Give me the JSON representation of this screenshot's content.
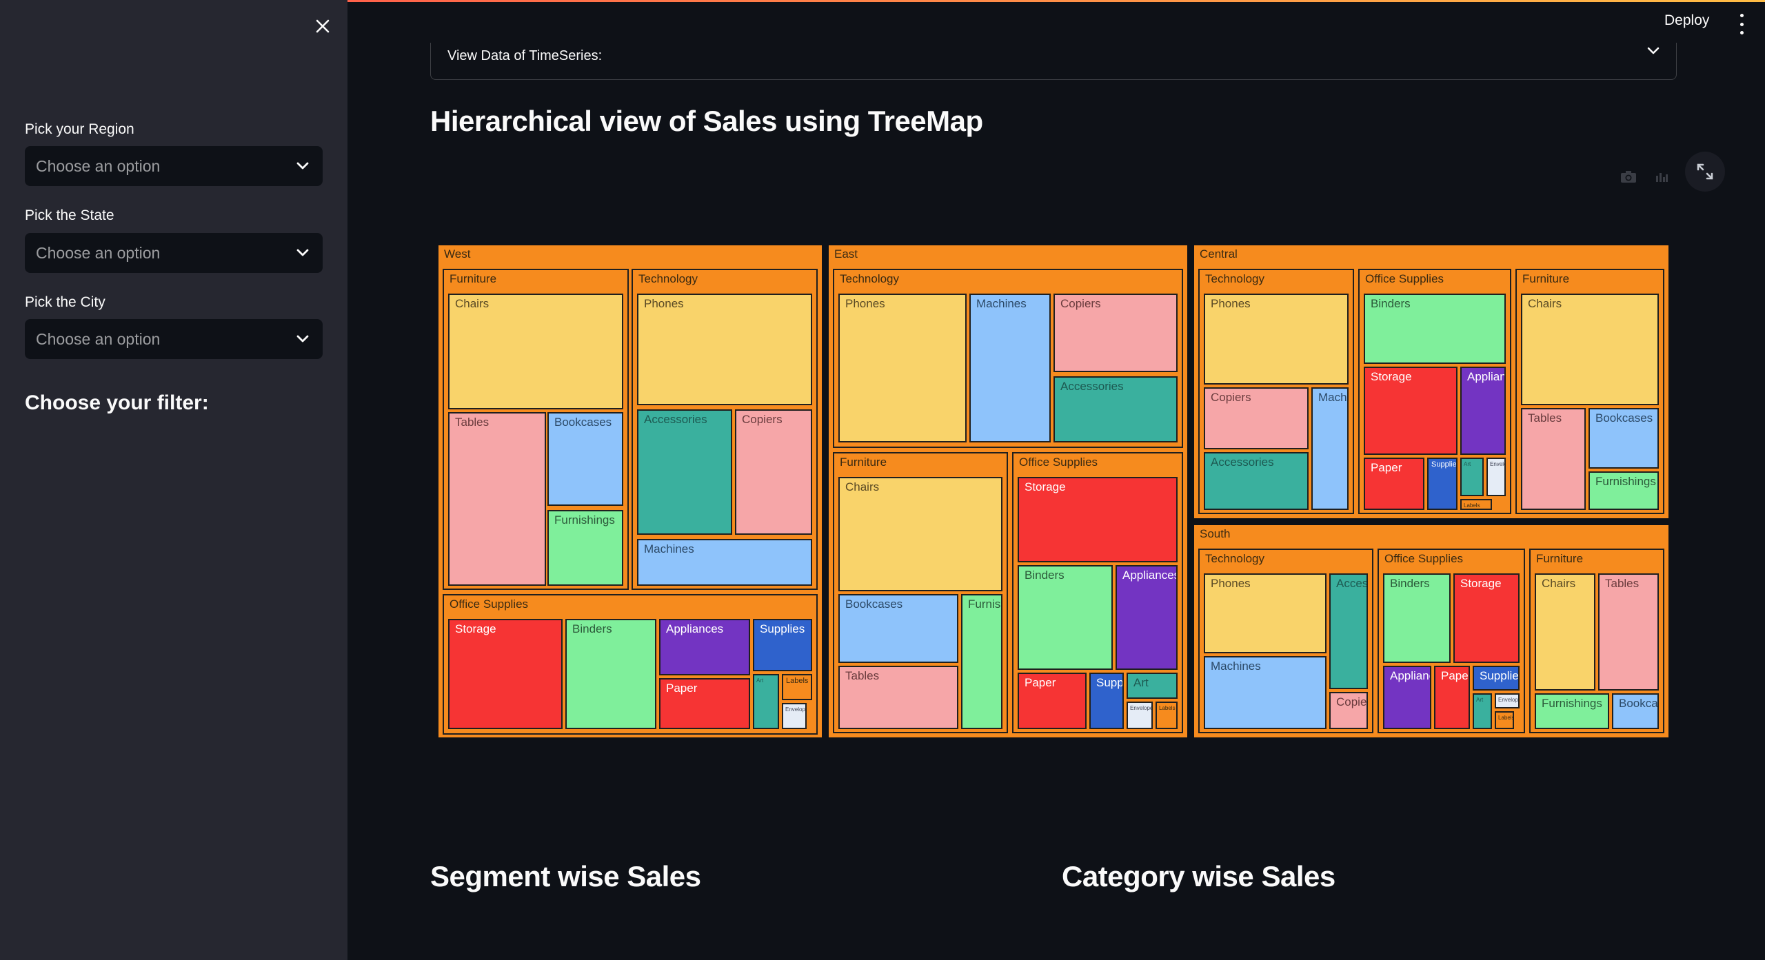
{
  "sidebar": {
    "filters": [
      {
        "label": "Pick your Region",
        "placeholder": "Choose an option"
      },
      {
        "label": "Pick the State",
        "placeholder": "Choose an option"
      },
      {
        "label": "Pick the City",
        "placeholder": "Choose an option"
      }
    ],
    "heading": "Choose your filter:"
  },
  "header": {
    "deploy_label": "Deploy"
  },
  "expander": {
    "label": "View Data of TimeSeries:"
  },
  "sections": {
    "treemap_title": "Hierarchical view of Sales using TreeMap",
    "segment_title": "Segment wise Sales",
    "category_title": "Category wise Sales"
  },
  "icons": {
    "close": "close-icon",
    "chevron": "chevron-down-icon",
    "menu": "vertical-dots-icon",
    "camera": "camera-icon",
    "autoscale": "bar-chart-icon",
    "fullscreen": "expand-icon"
  },
  "colors": {
    "background": "#0e1117",
    "sidebar": "#262730",
    "orange": "#f68b1e",
    "yellow": "#f9d36a",
    "blue": "#8ec3fb",
    "pink": "#f6a6a8",
    "teal": "#3ab09e",
    "green": "#7fef9b",
    "red": "#f63434",
    "purple": "#7334c2",
    "royal": "#2f62cc",
    "lightgray": "#e5ecf6"
  },
  "chart_data": {
    "type": "treemap",
    "title": "",
    "nodes": [
      {
        "id": "west",
        "label": "West",
        "parent": "",
        "color": "orange"
      },
      {
        "id": "west-furniture",
        "label": "Furniture",
        "parent": "west",
        "color": "orange"
      },
      {
        "id": "west-furniture-chairs",
        "label": "Chairs",
        "parent": "west-furniture",
        "color": "yellow"
      },
      {
        "id": "west-furniture-tables",
        "label": "Tables",
        "parent": "west-furniture",
        "color": "pink"
      },
      {
        "id": "west-furniture-bookcases",
        "label": "Bookcases",
        "parent": "west-furniture",
        "color": "blue"
      },
      {
        "id": "west-furniture-furnishings",
        "label": "Furnishings",
        "parent": "west-furniture",
        "color": "green"
      },
      {
        "id": "west-tech",
        "label": "Technology",
        "parent": "west",
        "color": "orange"
      },
      {
        "id": "west-tech-phones",
        "label": "Phones",
        "parent": "west-tech",
        "color": "yellow"
      },
      {
        "id": "west-tech-accessories",
        "label": "Accessories",
        "parent": "west-tech",
        "color": "teal"
      },
      {
        "id": "west-tech-copiers",
        "label": "Copiers",
        "parent": "west-tech",
        "color": "pink"
      },
      {
        "id": "west-tech-machines",
        "label": "Machines",
        "parent": "west-tech",
        "color": "blue"
      },
      {
        "id": "west-os",
        "label": "Office Supplies",
        "parent": "west",
        "color": "orange"
      },
      {
        "id": "west-os-storage",
        "label": "Storage",
        "parent": "west-os",
        "color": "red"
      },
      {
        "id": "west-os-binders",
        "label": "Binders",
        "parent": "west-os",
        "color": "green"
      },
      {
        "id": "west-os-appliances",
        "label": "Appliances",
        "parent": "west-os",
        "color": "purple"
      },
      {
        "id": "west-os-supplies",
        "label": "Supplies",
        "parent": "west-os",
        "color": "royal"
      },
      {
        "id": "west-os-paper",
        "label": "Paper",
        "parent": "west-os",
        "color": "red"
      },
      {
        "id": "west-os-art",
        "label": "Art",
        "parent": "west-os",
        "color": "teal"
      },
      {
        "id": "west-os-labels",
        "label": "Labels",
        "parent": "west-os",
        "color": "orange"
      },
      {
        "id": "west-os-envelopes",
        "label": "Envelopes",
        "parent": "west-os",
        "color": "lightgray"
      },
      {
        "id": "east",
        "label": "East",
        "parent": "",
        "color": "orange"
      },
      {
        "id": "east-tech",
        "label": "Technology",
        "parent": "east",
        "color": "orange"
      },
      {
        "id": "east-tech-phones",
        "label": "Phones",
        "parent": "east-tech",
        "color": "yellow"
      },
      {
        "id": "east-tech-machines",
        "label": "Machines",
        "parent": "east-tech",
        "color": "blue"
      },
      {
        "id": "east-tech-copiers",
        "label": "Copiers",
        "parent": "east-tech",
        "color": "pink"
      },
      {
        "id": "east-tech-accessories",
        "label": "Accessories",
        "parent": "east-tech",
        "color": "teal"
      },
      {
        "id": "east-furniture",
        "label": "Furniture",
        "parent": "east",
        "color": "orange"
      },
      {
        "id": "east-furniture-chairs",
        "label": "Chairs",
        "parent": "east-furniture",
        "color": "yellow"
      },
      {
        "id": "east-furniture-bookcases",
        "label": "Bookcases",
        "parent": "east-furniture",
        "color": "blue"
      },
      {
        "id": "east-furniture-tables",
        "label": "Tables",
        "parent": "east-furniture",
        "color": "pink"
      },
      {
        "id": "east-furniture-furnishings",
        "label": "Furnishings",
        "parent": "east-furniture",
        "color": "green"
      },
      {
        "id": "east-os",
        "label": "Office Supplies",
        "parent": "east",
        "color": "orange"
      },
      {
        "id": "east-os-storage",
        "label": "Storage",
        "parent": "east-os",
        "color": "red"
      },
      {
        "id": "east-os-binders",
        "label": "Binders",
        "parent": "east-os",
        "color": "green"
      },
      {
        "id": "east-os-appliances",
        "label": "Appliances",
        "parent": "east-os",
        "color": "purple"
      },
      {
        "id": "east-os-paper",
        "label": "Paper",
        "parent": "east-os",
        "color": "red"
      },
      {
        "id": "east-os-supplies",
        "label": "Supplies",
        "parent": "east-os",
        "color": "royal"
      },
      {
        "id": "east-os-art",
        "label": "Art",
        "parent": "east-os",
        "color": "teal"
      },
      {
        "id": "east-os-envelopes",
        "label": "Envelopes",
        "parent": "east-os",
        "color": "lightgray"
      },
      {
        "id": "east-os-labels",
        "label": "Labels",
        "parent": "east-os",
        "color": "orange"
      },
      {
        "id": "central",
        "label": "Central",
        "parent": "",
        "color": "orange"
      },
      {
        "id": "central-tech",
        "label": "Technology",
        "parent": "central",
        "color": "orange"
      },
      {
        "id": "central-tech-phones",
        "label": "Phones",
        "parent": "central-tech",
        "color": "yellow"
      },
      {
        "id": "central-tech-copiers",
        "label": "Copiers",
        "parent": "central-tech",
        "color": "pink"
      },
      {
        "id": "central-tech-machines",
        "label": "Machines",
        "parent": "central-tech",
        "color": "blue"
      },
      {
        "id": "central-tech-accessories",
        "label": "Accessories",
        "parent": "central-tech",
        "color": "teal"
      },
      {
        "id": "central-os",
        "label": "Office Supplies",
        "parent": "central",
        "color": "orange"
      },
      {
        "id": "central-os-binders",
        "label": "Binders",
        "parent": "central-os",
        "color": "green"
      },
      {
        "id": "central-os-storage",
        "label": "Storage",
        "parent": "central-os",
        "color": "red"
      },
      {
        "id": "central-os-appliances",
        "label": "Appliances",
        "parent": "central-os",
        "color": "purple"
      },
      {
        "id": "central-os-paper",
        "label": "Paper",
        "parent": "central-os",
        "color": "red"
      },
      {
        "id": "central-os-supplies",
        "label": "Supplies",
        "parent": "central-os",
        "color": "royal"
      },
      {
        "id": "central-os-art",
        "label": "Art",
        "parent": "central-os",
        "color": "teal"
      },
      {
        "id": "central-os-envelopes",
        "label": "Envelopes",
        "parent": "central-os",
        "color": "lightgray"
      },
      {
        "id": "central-os-labels",
        "label": "Labels",
        "parent": "central-os",
        "color": "orange"
      },
      {
        "id": "central-furniture",
        "label": "Furniture",
        "parent": "central",
        "color": "orange"
      },
      {
        "id": "central-furniture-chairs",
        "label": "Chairs",
        "parent": "central-furniture",
        "color": "yellow"
      },
      {
        "id": "central-furniture-tables",
        "label": "Tables",
        "parent": "central-furniture",
        "color": "pink"
      },
      {
        "id": "central-furniture-bookcases",
        "label": "Bookcases",
        "parent": "central-furniture",
        "color": "blue"
      },
      {
        "id": "central-furniture-furnishings",
        "label": "Furnishings",
        "parent": "central-furniture",
        "color": "green"
      },
      {
        "id": "south",
        "label": "South",
        "parent": "",
        "color": "orange"
      },
      {
        "id": "south-tech",
        "label": "Technology",
        "parent": "south",
        "color": "orange"
      },
      {
        "id": "south-tech-phones",
        "label": "Phones",
        "parent": "south-tech",
        "color": "yellow"
      },
      {
        "id": "south-tech-accessories",
        "label": "Accessories",
        "parent": "south-tech",
        "color": "teal"
      },
      {
        "id": "south-tech-machines",
        "label": "Machines",
        "parent": "south-tech",
        "color": "blue"
      },
      {
        "id": "south-tech-copiers",
        "label": "Copiers",
        "parent": "south-tech",
        "color": "pink"
      },
      {
        "id": "south-os",
        "label": "Office Supplies",
        "parent": "south",
        "color": "orange"
      },
      {
        "id": "south-os-binders",
        "label": "Binders",
        "parent": "south-os",
        "color": "green"
      },
      {
        "id": "south-os-storage",
        "label": "Storage",
        "parent": "south-os",
        "color": "red"
      },
      {
        "id": "south-os-appliances",
        "label": "Appliances",
        "parent": "south-os",
        "color": "purple"
      },
      {
        "id": "south-os-paper",
        "label": "Paper",
        "parent": "south-os",
        "color": "red"
      },
      {
        "id": "south-os-supplies",
        "label": "Supplies",
        "parent": "south-os",
        "color": "royal"
      },
      {
        "id": "south-os-art",
        "label": "Art",
        "parent": "south-os",
        "color": "teal"
      },
      {
        "id": "south-os-envelopes",
        "label": "Envelopes",
        "parent": "south-os",
        "color": "lightgray"
      },
      {
        "id": "south-os-labels",
        "label": "Labels",
        "parent": "south-os",
        "color": "orange"
      },
      {
        "id": "south-furniture",
        "label": "Furniture",
        "parent": "south",
        "color": "orange"
      },
      {
        "id": "south-furniture-chairs",
        "label": "Chairs",
        "parent": "south-furniture",
        "color": "yellow"
      },
      {
        "id": "south-furniture-tables",
        "label": "Tables",
        "parent": "south-furniture",
        "color": "pink"
      },
      {
        "id": "south-furniture-furnishings",
        "label": "Furnishings",
        "parent": "south-furniture",
        "color": "green"
      },
      {
        "id": "south-furniture-bookcases",
        "label": "Bookcases",
        "parent": "south-furniture",
        "color": "blue"
      }
    ]
  }
}
